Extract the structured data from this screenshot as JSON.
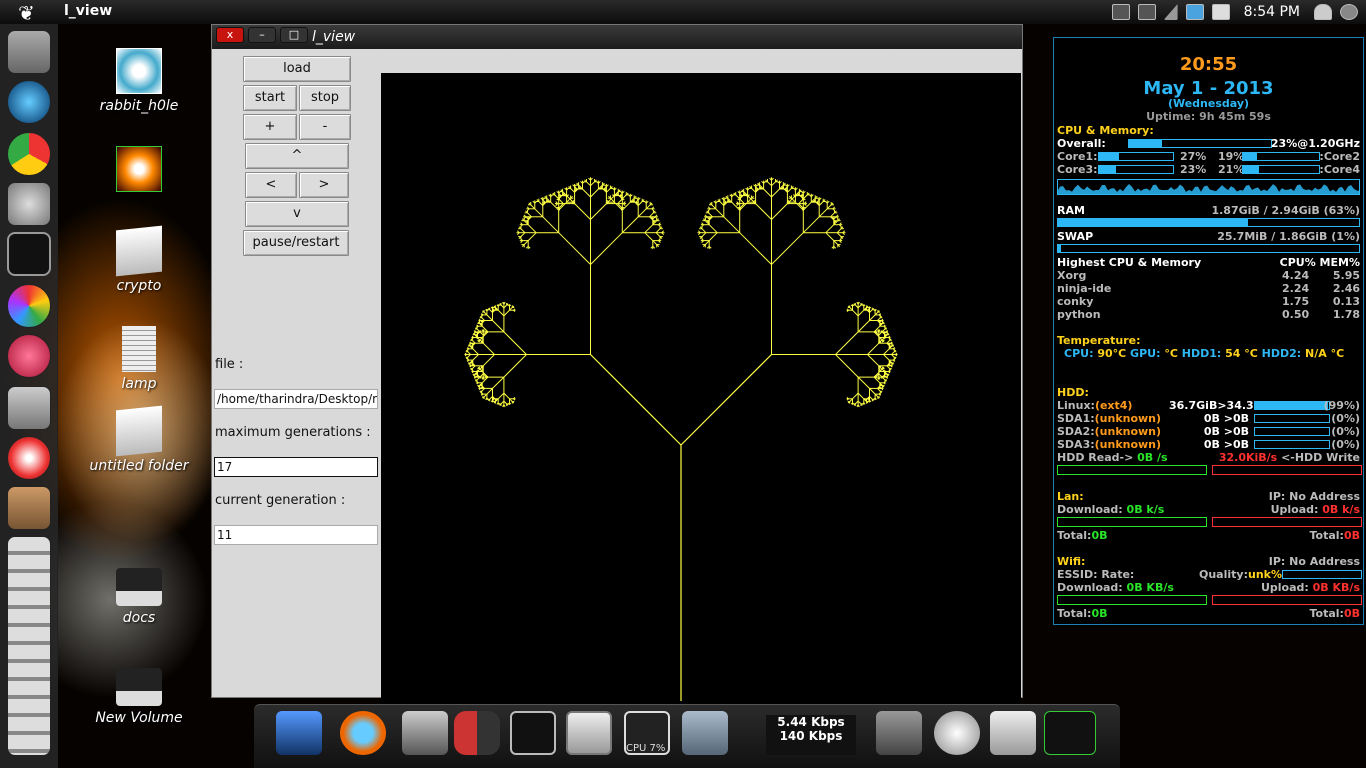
{
  "panel": {
    "app_title": "l_view",
    "clock": "8:54 PM"
  },
  "window": {
    "title": "l_view",
    "close": "x",
    "minimize": "–",
    "maximize": "□"
  },
  "controls": {
    "load": "load",
    "start": "start",
    "stop": "stop",
    "plus": "+",
    "minus": "-",
    "up": "^",
    "left": "<",
    "right": ">",
    "down": "v",
    "pause": "pause/restart",
    "file_label": "file :",
    "file_value": "/home/tharindra/Desktop/r",
    "maxgen_label": "maximum generations :",
    "maxgen_value": "17",
    "curgen_label": "current generation :",
    "curgen_value": "11"
  },
  "desktop_icons": [
    {
      "label": "rabbit_h0le"
    },
    {
      "label": "crypto"
    },
    {
      "label": "lamp"
    },
    {
      "label": "untitled folder"
    },
    {
      "label": "docs"
    },
    {
      "label": "New Volume"
    }
  ],
  "dock": {
    "net_down": "5.44 Kbps",
    "net_up": "140 Kbps",
    "cpu_label": "CPU 7%"
  },
  "conky": {
    "time": "20:55",
    "date": "May  1 - 2013",
    "weekday": "(Wednesday)",
    "uptime": "Uptime: 9h 45m 59s",
    "cpu_header": "CPU & Memory:",
    "overall_label": "Overall:",
    "overall_value": "23%@1.20GHz",
    "overall_fraction": 0.23,
    "core1": "Core1:",
    "core1_pct": "27%",
    "core1_fraction": 0.27,
    "core2": ":Core2",
    "core2_pct": "19%",
    "core2_fraction": 0.19,
    "core3": "Core3:",
    "core3_pct": "23%",
    "core3_fraction": 0.23,
    "core4": ":Core4",
    "core4_pct": "21%",
    "core4_fraction": 0.21,
    "ram_label": "RAM",
    "ram_value": "1.87GiB / 2.94GiB (63%)",
    "ram_fraction": 0.63,
    "swap_label": "SWAP",
    "swap_value": "25.7MiB / 1.86GiB (1%)",
    "swap_fraction": 0.01,
    "top_header": "Highest CPU & Memory",
    "top_cols": "CPU% MEM%",
    "procs": [
      {
        "name": "Xorg",
        "cpu": "4.24",
        "mem": "5.95"
      },
      {
        "name": "ninja-ide",
        "cpu": "2.24",
        "mem": "2.46"
      },
      {
        "name": "conky",
        "cpu": "1.75",
        "mem": "0.13"
      },
      {
        "name": "python",
        "cpu": "0.50",
        "mem": "1.78"
      }
    ],
    "temp_header": "Temperature:",
    "temp_cpu_label": "CPU:",
    "temp_cpu": "90°C",
    "temp_gpu_label": "GPU:",
    "temp_gpu": "°C",
    "temp_hdd1_label": "HDD1:",
    "temp_hdd1": "54 °C",
    "temp_hdd2_label": "HDD2:",
    "temp_hdd2": "N/A °C",
    "hdd_header": "HDD:",
    "disks": [
      {
        "name": "Linux:",
        "fs": "(ext4)",
        "size": "36.7GiB>34.3GiB",
        "pct": "(99%)",
        "fraction": 0.99
      },
      {
        "name": "SDA1:",
        "fs": "(unknown)",
        "size": "0B  >0B",
        "pct": "(0%)",
        "fraction": 0
      },
      {
        "name": "SDA2:",
        "fs": "(unknown)",
        "size": "0B  >0B",
        "pct": "(0%)",
        "fraction": 0
      },
      {
        "name": "SDA3:",
        "fs": "(unknown)",
        "size": "0B  >0B",
        "pct": "(0%)",
        "fraction": 0
      }
    ],
    "hdd_read": "HDD Read-> ",
    "hdd_read_val": "0B  /s",
    "hdd_write_val": "32.0KiB/s",
    "hdd_write": " <-HDD Write",
    "lan_header": "Lan:",
    "lan_ip": "IP: No Address",
    "lan_download": "Download: ",
    "lan_download_val": "0B   k/s",
    "lan_upload": "Upload: ",
    "lan_upload_val": "0B   k/s",
    "lan_total_label": "Total:",
    "lan_total_down": "0B",
    "lan_total_up": "0B",
    "wifi_header": "Wifi:",
    "wifi_ip": "IP: No Address",
    "essid": "ESSID: Rate:",
    "quality": "Quality:",
    "quality_val": "unk%",
    "wifi_download": "Download: ",
    "wifi_download_val": "0B  KB/s",
    "wifi_upload": "Upload: ",
    "wifi_upload_val": "0B  KB/s",
    "wifi_total_label": "Total:",
    "wifi_total_down": "0B",
    "wifi_total_up": "0B"
  },
  "colors": {
    "fractal": "#ffff44",
    "accent": "#2db7f5",
    "clock": "#ff9a1c"
  }
}
